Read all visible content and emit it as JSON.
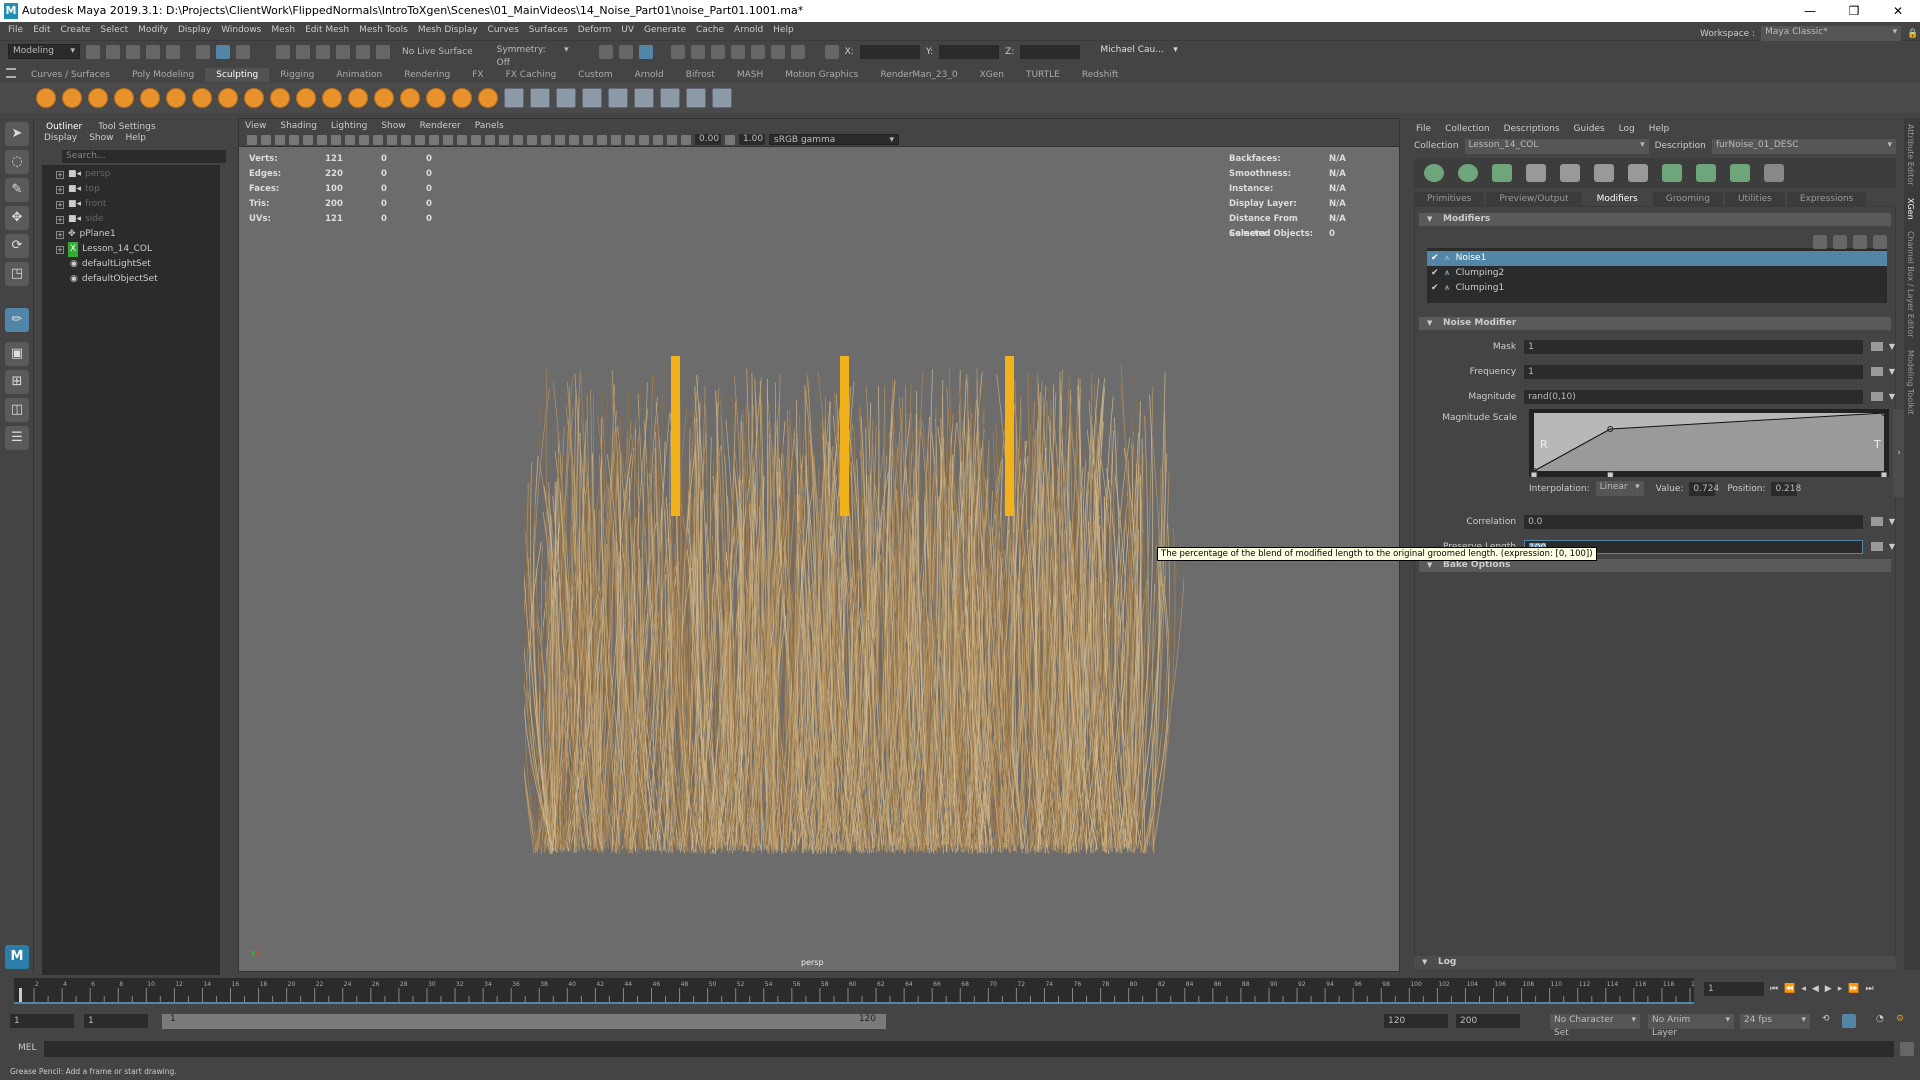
{
  "window": {
    "title": "Autodesk Maya 2019.3.1: D:\\Projects\\ClientWork\\FlippedNormals\\IntroToXgen\\Scenes\\01_MainVideos\\14_Noise_Part01\\noise_Part01.1001.ma*",
    "minimize": "—",
    "maximize": "❐",
    "close": "✕"
  },
  "menubar": [
    "File",
    "Edit",
    "Create",
    "Select",
    "Modify",
    "Display",
    "Windows",
    "Mesh",
    "Edit Mesh",
    "Mesh Tools",
    "Mesh Display",
    "Curves",
    "Surfaces",
    "Deform",
    "UV",
    "Generate",
    "Cache",
    "Arnold",
    "Help"
  ],
  "statusline": {
    "menuset": "Modeling",
    "live_surface": "No Live Surface",
    "symmetry": "Symmetry: Off",
    "x_label": "X:",
    "y_label": "Y:",
    "z_label": "Z:",
    "user": "Michael Cau...",
    "workspace_label": "Workspace :",
    "workspace": "Maya Classic*"
  },
  "shelf_tabs": [
    "Curves / Surfaces",
    "Poly Modeling",
    "Sculpting",
    "Rigging",
    "Animation",
    "Rendering",
    "FX",
    "FX Caching",
    "Custom",
    "Arnold",
    "Bifrost",
    "MASH",
    "Motion Graphics",
    "RenderMan_23_0",
    "XGen",
    "TURTLE",
    "Redshift"
  ],
  "shelf_active": "Sculpting",
  "outliner": {
    "tabs": [
      "Outliner",
      "Tool Settings"
    ],
    "menu": [
      "Display",
      "Show",
      "Help"
    ],
    "search_placeholder": "Search...",
    "items": [
      {
        "label": "persp",
        "icon": "camera-icon",
        "dim": true
      },
      {
        "label": "top",
        "icon": "camera-icon",
        "dim": true
      },
      {
        "label": "front",
        "icon": "camera-icon",
        "dim": true
      },
      {
        "label": "side",
        "icon": "camera-icon",
        "dim": true
      },
      {
        "label": "pPlane1",
        "icon": "transform-icon",
        "dim": false
      },
      {
        "label": "Lesson_14_COL",
        "icon": "xgen-collection-icon",
        "dim": false
      },
      {
        "label": "defaultLightSet",
        "icon": "set-icon",
        "dim": false
      },
      {
        "label": "defaultObjectSet",
        "icon": "set-icon",
        "dim": false
      }
    ]
  },
  "viewport": {
    "menu": [
      "View",
      "Shading",
      "Lighting",
      "Show",
      "Renderer",
      "Panels"
    ],
    "exposure": "0.00",
    "gamma": "1.00",
    "color_space": "sRGB gamma",
    "camera": "persp",
    "hud_left": [
      [
        "Verts:",
        "121",
        "0",
        "0"
      ],
      [
        "Edges:",
        "220",
        "0",
        "0"
      ],
      [
        "Faces:",
        "100",
        "0",
        "0"
      ],
      [
        "Tris:",
        "200",
        "0",
        "0"
      ],
      [
        "UVs:",
        "121",
        "0",
        "0"
      ]
    ],
    "hud_right": [
      [
        "Backfaces:",
        "N/A"
      ],
      [
        "Smoothness:",
        "N/A"
      ],
      [
        "Instance:",
        "N/A"
      ],
      [
        "Display Layer:",
        "N/A"
      ],
      [
        "Distance From Camera:",
        "N/A"
      ],
      [
        "Selected Objects:",
        "0"
      ]
    ],
    "guide_color": "#f2b21c",
    "hair_color": "#b89866"
  },
  "xgen": {
    "menu": [
      "File",
      "Collection",
      "Descriptions",
      "Guides",
      "Log",
      "Help"
    ],
    "collection_label": "Collection",
    "collection": "Lesson_14_COL",
    "description_label": "Description",
    "description": "furNoise_01_DESC",
    "tabs": [
      "Primitives",
      "Preview/Output",
      "Modifiers",
      "Grooming",
      "Utilities",
      "Expressions"
    ],
    "active_tab": "Modifiers",
    "modifiers_section": "Modifiers",
    "modifiers": [
      {
        "name": "Noise1",
        "checked": true,
        "selected": true
      },
      {
        "name": "Clumping2",
        "checked": true,
        "selected": false
      },
      {
        "name": "Clumping1",
        "checked": true,
        "selected": false
      }
    ],
    "noise_section": "Noise Modifier",
    "attrs": {
      "mask_label": "Mask",
      "mask": "1",
      "frequency_label": "Frequency",
      "frequency": "1",
      "magnitude_label": "Magnitude",
      "magnitude": "rand(0,10)",
      "magnitude_scale_label": "Magnitude Scale",
      "correlation_label": "Correlation",
      "correlation": "0.0",
      "preserve_label": "Preserve Length",
      "preserve": "100"
    },
    "ramp": {
      "left_label": "R",
      "right_label": "T",
      "points": [
        [
          0,
          0
        ],
        [
          0.218,
          0.724
        ],
        [
          1,
          1
        ]
      ],
      "interpolation_label": "Interpolation:",
      "interpolation": "Linear",
      "value_label": "Value:",
      "value": "0.724",
      "position_label": "Position:",
      "position": "0.218"
    },
    "bake_section": "Bake Options",
    "log_label": "Log",
    "tooltip": "The percentage of the blend of modified length to the original groomed length. (expression: [0, 100])"
  },
  "side_tabs": [
    "Attribute Editor",
    "XGen",
    "Channel Box / Layer Editor",
    "Modeling Toolkit"
  ],
  "timeline": {
    "start": 1,
    "end": 120,
    "step": 2,
    "current": "1"
  },
  "range": {
    "start": "1",
    "anim_start": "1",
    "range_start": "1",
    "range_end": "120",
    "end": "120",
    "anim_end": "200",
    "character_set": "No Character Set",
    "anim_layer": "No Anim Layer",
    "fps": "24 fps"
  },
  "mel": {
    "label": "MEL"
  },
  "helpline": "Grease Pencil: Add a frame or start drawing."
}
